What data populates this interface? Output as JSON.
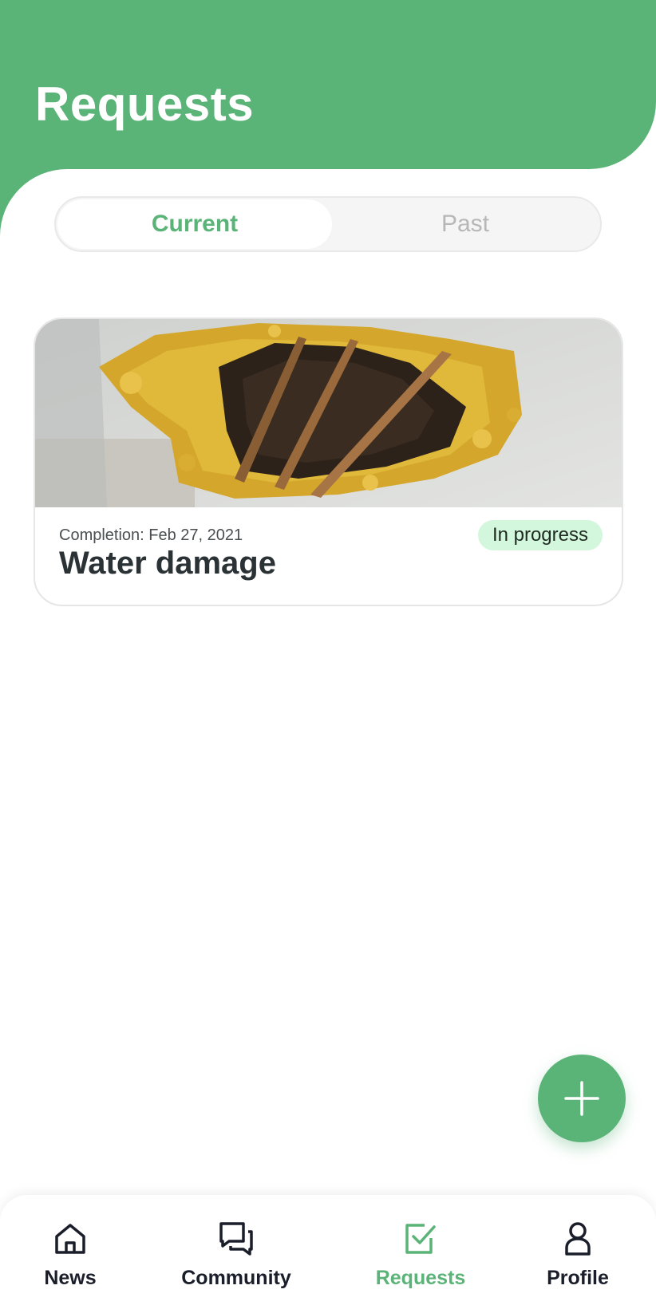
{
  "colors": {
    "accent": "#5ab377",
    "badge_bg": "#d3f7dd",
    "text_dark": "#2b3236"
  },
  "header": {
    "title": "Requests"
  },
  "segment": {
    "current_label": "Current",
    "past_label": "Past",
    "selected": "Current"
  },
  "requests": [
    {
      "image_icon": "ceiling-water-damage-photo",
      "completion": "Completion: Feb 27, 2021",
      "title": "Water damage",
      "status": "In progress"
    }
  ],
  "fab": {
    "icon": "plus-icon"
  },
  "bottom_nav": {
    "items": [
      {
        "label": "News",
        "icon": "home-icon",
        "active": false
      },
      {
        "label": "Community",
        "icon": "chat-icon",
        "active": false
      },
      {
        "label": "Requests",
        "icon": "checkbox-icon",
        "active": true
      },
      {
        "label": "Profile",
        "icon": "person-icon",
        "active": false
      }
    ]
  }
}
